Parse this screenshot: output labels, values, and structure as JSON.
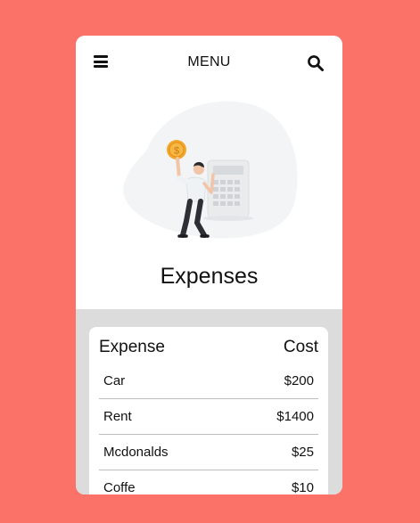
{
  "header": {
    "title": "MENU",
    "menu_icon": "hamburger-icon",
    "search_icon": "search-icon"
  },
  "hero": {
    "illustration": "person-with-coin-and-calculator"
  },
  "page": {
    "title": "Expenses"
  },
  "table": {
    "columns": [
      "Expense",
      "Cost"
    ],
    "rows": [
      {
        "name": "Car",
        "cost": "$200"
      },
      {
        "name": "Rent",
        "cost": "$1400"
      },
      {
        "name": "Mcdonalds",
        "cost": "$25"
      },
      {
        "name": "Coffe",
        "cost": "$10"
      }
    ]
  },
  "colors": {
    "background": "#fa7268",
    "card": "#ffffff",
    "panel": "#dcdcdc",
    "coin": "#f4a62a"
  }
}
